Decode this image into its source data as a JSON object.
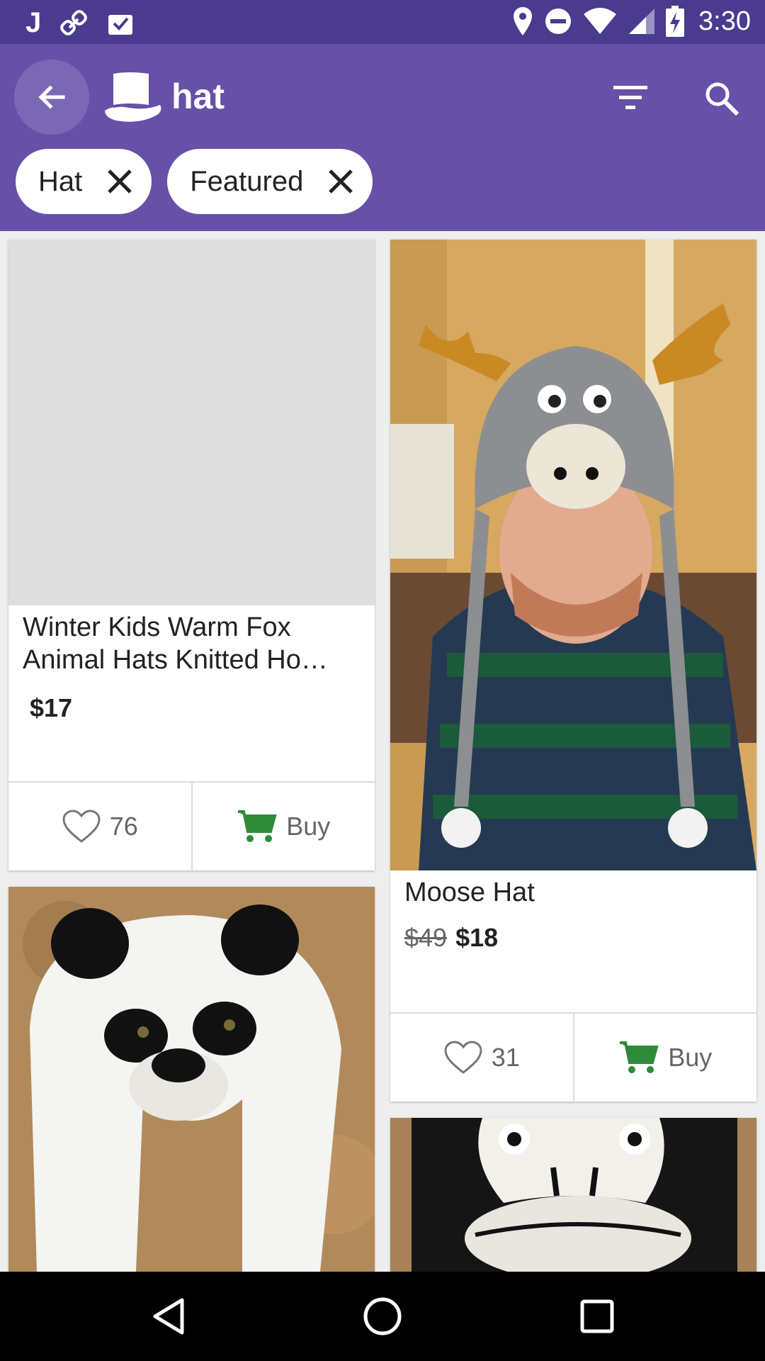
{
  "status_bar": {
    "time": "3:30",
    "left_icons": [
      "j-app-icon",
      "link-icon",
      "inbox-check-icon"
    ],
    "right_icons": [
      "location-icon",
      "do-not-disturb-icon",
      "wifi-icon",
      "signal-icon",
      "battery-charging-icon"
    ]
  },
  "app_bar": {
    "back_icon": "arrow-left-icon",
    "logo_icon": "top-hat-icon",
    "title": "hat",
    "filter_icon": "filter-icon",
    "search_icon": "search-icon",
    "chips": [
      {
        "label": "Hat"
      },
      {
        "label": "Featured"
      }
    ]
  },
  "products": [
    {
      "title": "Winter Kids Warm Fox Animal Hats Knitted  Ho…",
      "price": "$17",
      "likes": "76",
      "buy_label": "Buy"
    },
    {
      "title": "Moose Hat",
      "old_price": "$49",
      "price": "$18",
      "likes": "31",
      "buy_label": "Buy"
    }
  ],
  "colors": {
    "status_bar": "#4a3b8e",
    "app_bar": "#6650a8",
    "cart_green": "#2e8b3a"
  },
  "nav_bar": {
    "icons": [
      "back-triangle-icon",
      "home-circle-icon",
      "recents-square-icon"
    ]
  }
}
